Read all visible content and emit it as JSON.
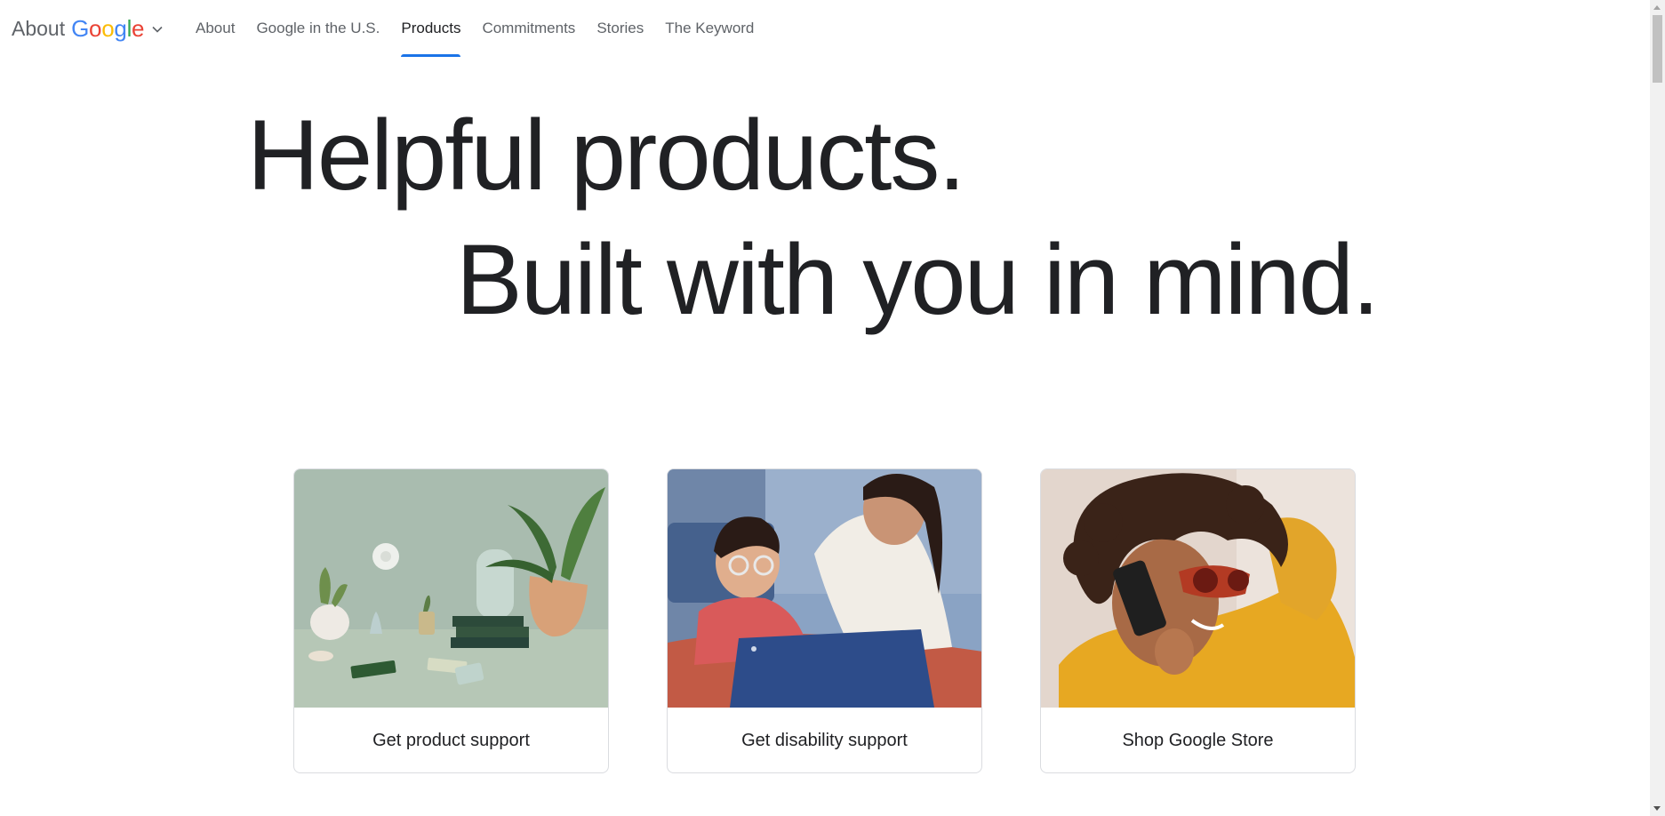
{
  "brand": {
    "about_label": "About",
    "google_letters": [
      "G",
      "o",
      "o",
      "g",
      "l",
      "e"
    ],
    "menu_icon": "chevron-down-icon"
  },
  "nav": {
    "items": [
      {
        "label": "About",
        "active": false
      },
      {
        "label": "Google in the U.S.",
        "active": false
      },
      {
        "label": "Products",
        "active": true
      },
      {
        "label": "Commitments",
        "active": false
      },
      {
        "label": "Stories",
        "active": false
      },
      {
        "label": "The Keyword",
        "active": false
      }
    ]
  },
  "hero": {
    "line1": "Helpful products.",
    "line2": "Built with you in mind."
  },
  "cards": [
    {
      "label": "Get product support",
      "image": "smart-home-devices-still-life"
    },
    {
      "label": "Get disability support",
      "image": "mother-and-child-with-laptop"
    },
    {
      "label": "Shop Google Store",
      "image": "woman-with-phone-and-sunglasses"
    }
  ],
  "colors": {
    "accent": "#1a73e8",
    "text_primary": "#202124",
    "text_secondary": "#5f6368",
    "google_blue": "#4285f4",
    "google_red": "#ea4335",
    "google_yellow": "#fbbc05",
    "google_green": "#34a853"
  }
}
